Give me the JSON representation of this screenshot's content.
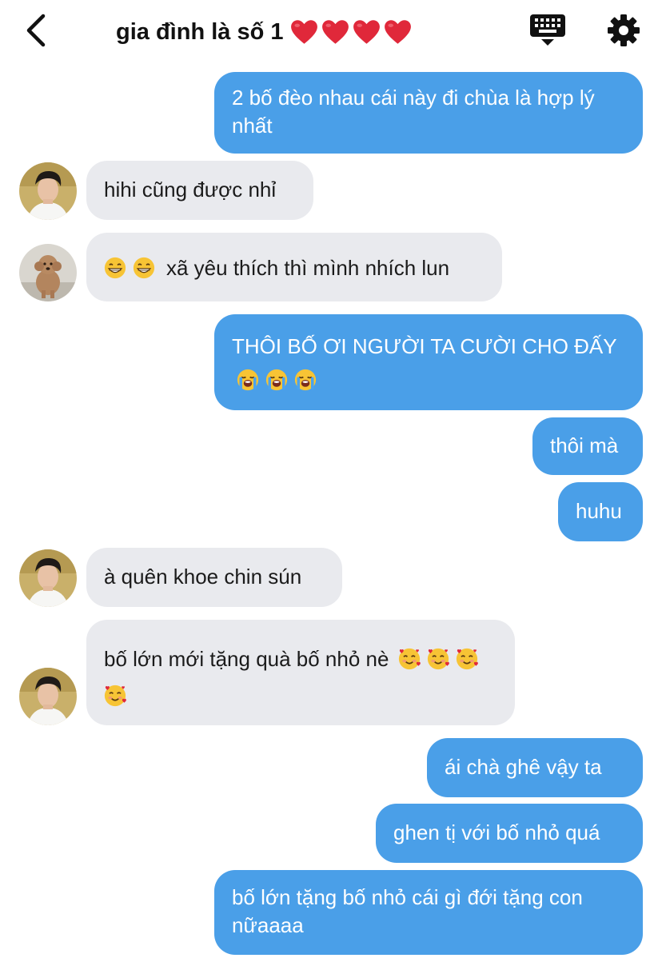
{
  "header": {
    "title": "gia đình là số 1",
    "hearts": [
      "red-heart",
      "red-heart",
      "red-heart",
      "red-heart"
    ],
    "icons": [
      "back-chevron-icon",
      "keyboard-icon",
      "gear-icon"
    ]
  },
  "colors": {
    "outgoing_bubble": "#4a9fe8",
    "incoming_bubble": "#e9eaee",
    "heart": "#e0283a"
  },
  "messages": [
    {
      "from": "me",
      "text": "2 bố đèo nhau cái này đi chùa là hợp lý nhất"
    },
    {
      "from": "member-boy",
      "text": "hihi cũng được nhỉ"
    },
    {
      "from": "member-dog",
      "text": "xã yêu thích thì mình nhích lun",
      "emojis": [
        "grinning-face",
        "grinning-face"
      ]
    },
    {
      "from": "me",
      "text": "THÔI BỐ ƠI NGƯỜI TA CƯỜI CHO ĐẤY",
      "emojis": [
        "loudly-crying-face",
        "loudly-crying-face",
        "loudly-crying-face"
      ]
    },
    {
      "from": "me",
      "text": "thôi mà"
    },
    {
      "from": "me",
      "text": "huhu"
    },
    {
      "from": "member-boy",
      "text": "à quên khoe chin sún"
    },
    {
      "from": "member-boy",
      "text": "bố lớn mới tặng quà bố nhỏ nè",
      "emojis": [
        "smiling-face-with-hearts",
        "smiling-face-with-hearts",
        "smiling-face-with-hearts",
        "smiling-face-with-hearts"
      ]
    },
    {
      "from": "me",
      "text": "ái chà ghê vậy ta"
    },
    {
      "from": "me",
      "text": "ghen tị với bố nhỏ quá"
    },
    {
      "from": "me",
      "text": "bố lớn tặng bố nhỏ cái gì đới tặng con nữaaaa"
    }
  ]
}
